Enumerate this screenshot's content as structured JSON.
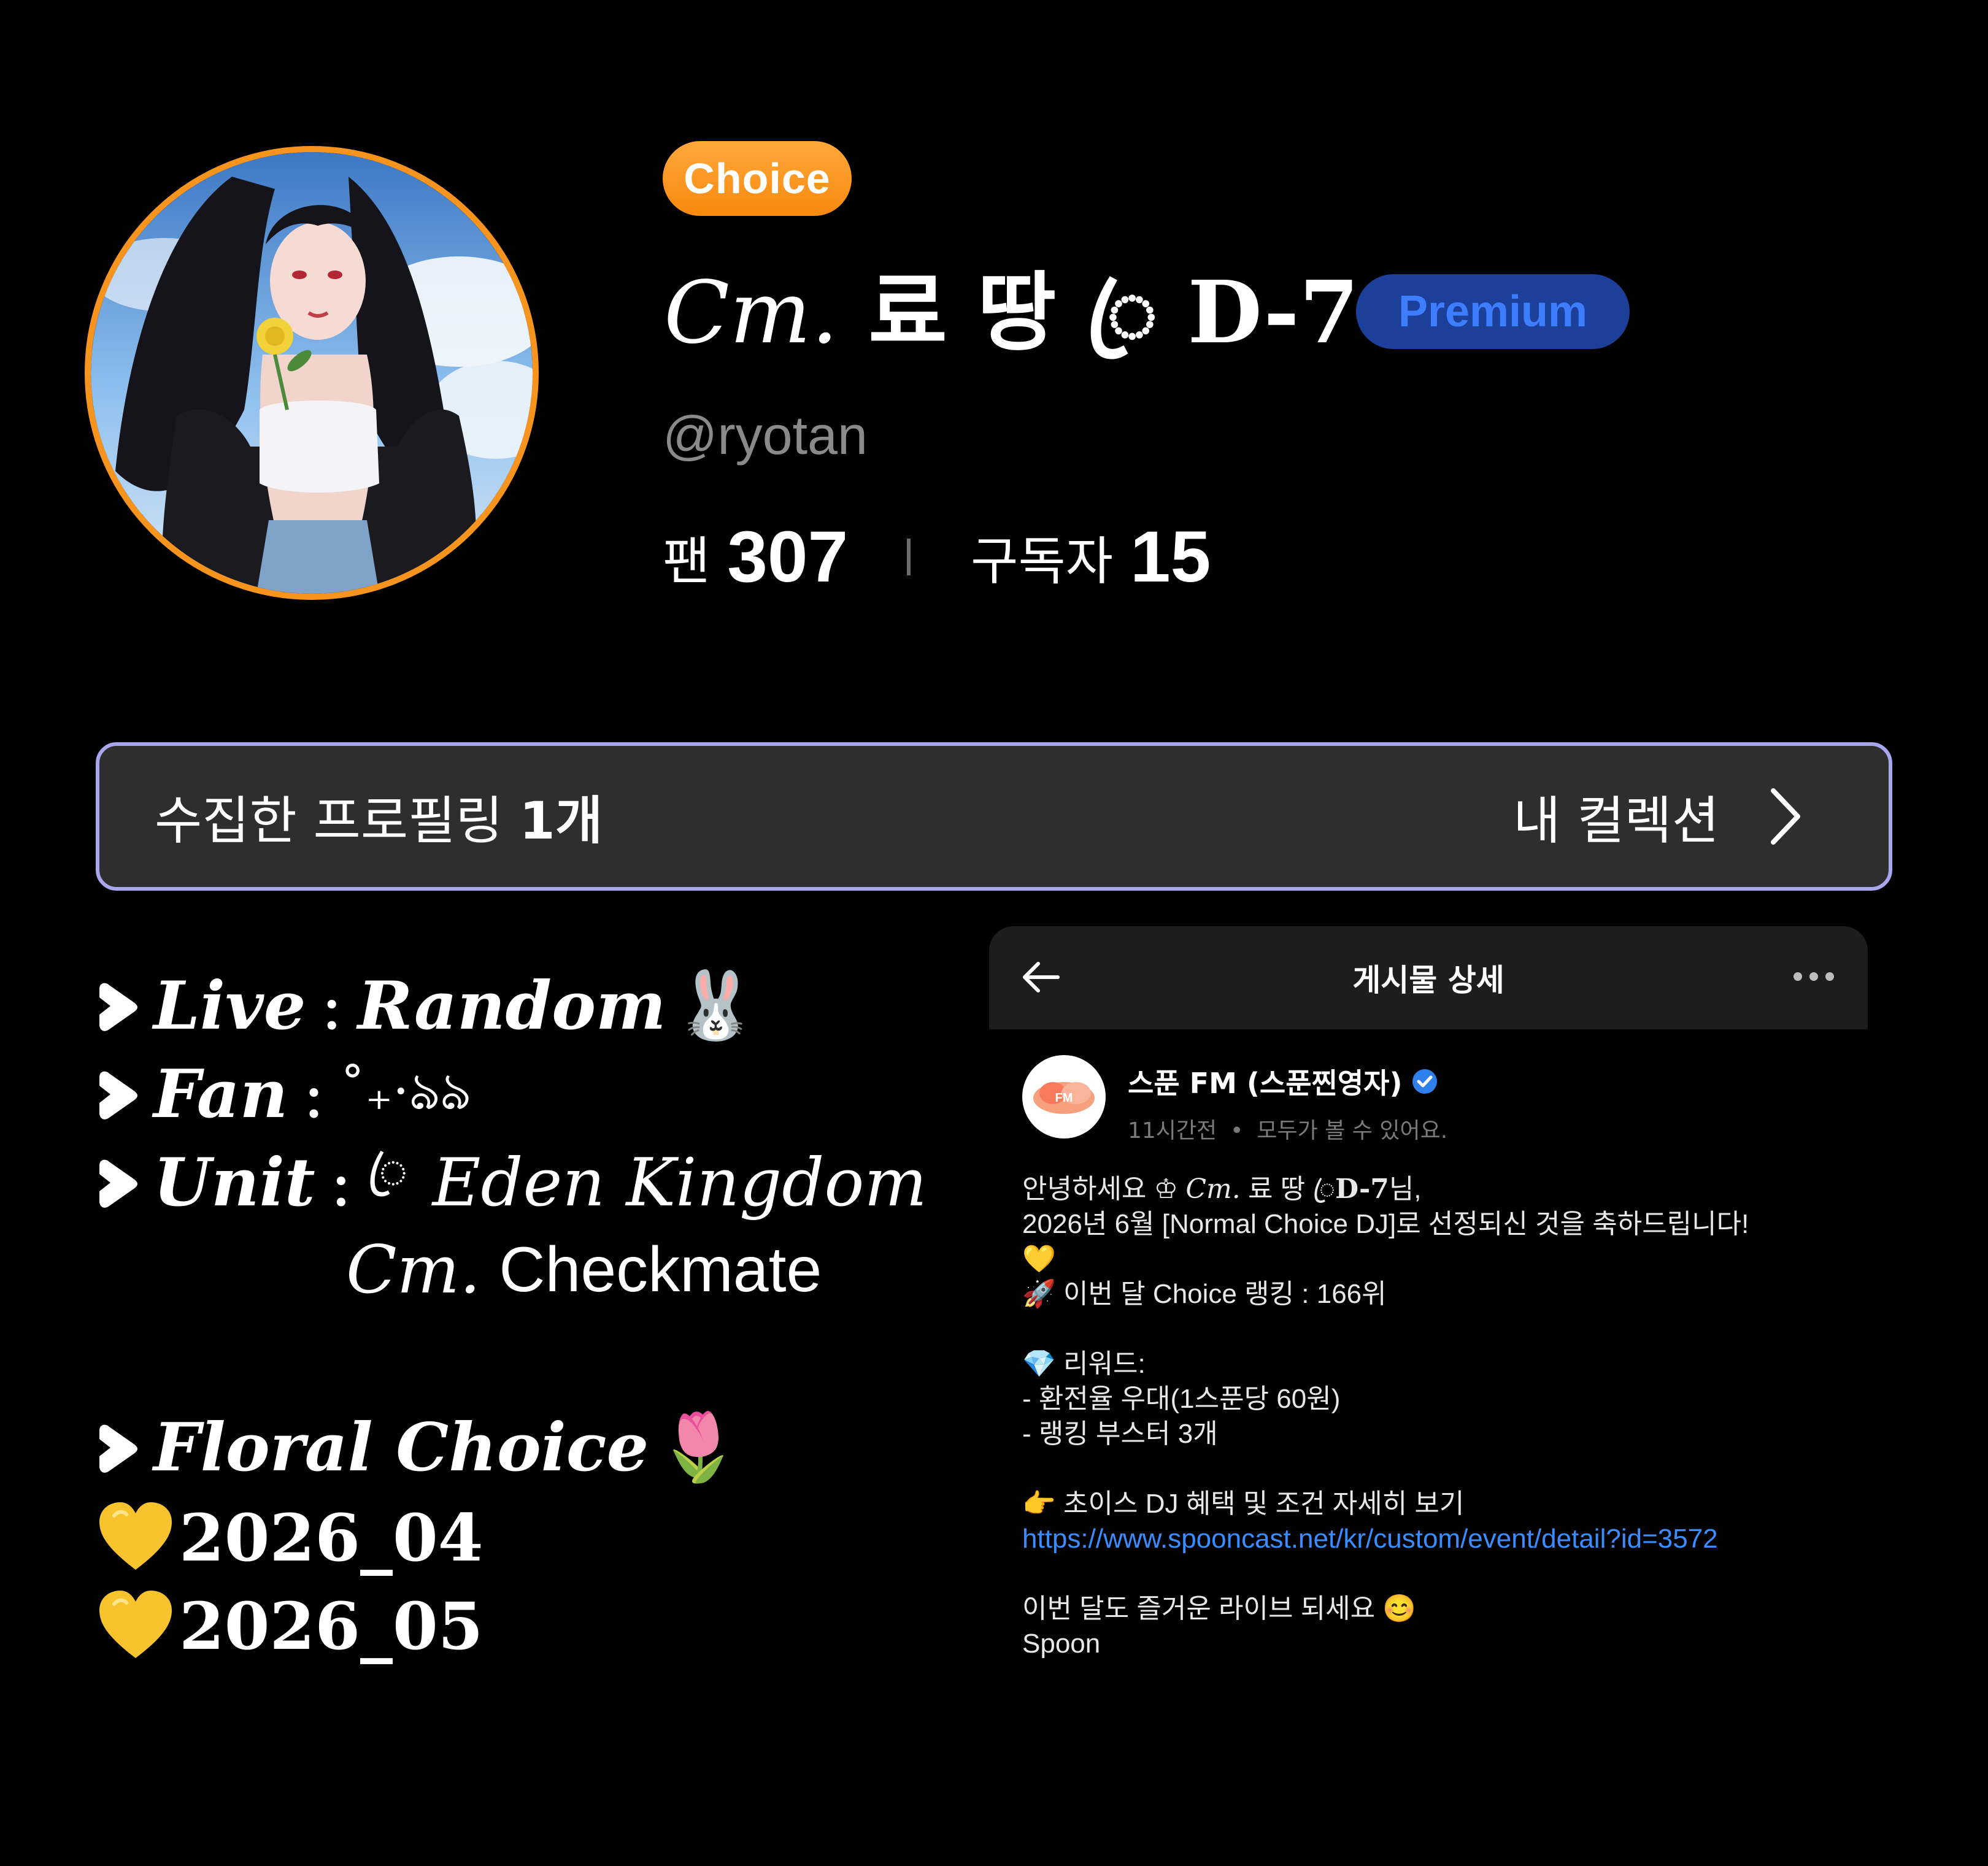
{
  "profile": {
    "choice_badge": "Choice",
    "name_script": "Cm.",
    "name_text": "료 땅",
    "name_ring": "ꦿ",
    "name_suffix": "D-7",
    "premium_badge": "Premium",
    "handle": "@ryotan",
    "stats": {
      "fans_label": "팬",
      "fans_value": "307",
      "subscribers_label": "구독자",
      "subscribers_value": "15"
    },
    "colors": {
      "avatar_ring": "#f7941d",
      "choice_badge": "#f7941d",
      "premium_badge_bg": "#1c3f9a",
      "premium_badge_text": "#3d7dff",
      "collection_border": "#a9a6f0"
    }
  },
  "collection": {
    "label": "수집한 프로필링",
    "count": "1개",
    "link_label": "내 컬렉션",
    "icon": "chevron-right-icon"
  },
  "bio": {
    "live_key": "Live",
    "live_sep": ":",
    "live_value": "Random",
    "live_emoji": "🐰",
    "fan_key": "Fan",
    "fan_sep": ":",
    "fan_value": "˚₊·ঌ⁠ঌ",
    "unit_key": "Unit",
    "unit_sep": ":",
    "unit_ring": "ꦿ",
    "unit_value": "Eden Kingdom",
    "unit_line2_script": "Cm.",
    "unit_line2_text": "Checkmate",
    "floral_label": "Floral Choice",
    "floral_emoji": "🌷",
    "months": [
      "2026_04",
      "2026_05"
    ],
    "bullet_icon": "arrow-bullet-icon",
    "heart_icon": "yellow-heart-icon"
  },
  "post": {
    "header_title": "게시물 상세",
    "back_icon": "arrow-left-icon",
    "more_icon": "more-horizontal-icon",
    "author_name": "스푼 FM (스푼찐영자)",
    "author_verified": true,
    "timestamp": "11시간전",
    "visibility": "모두가 볼 수 있어요.",
    "logo_text": "FM",
    "body": {
      "greeting_prefix": "안녕하세요",
      "greeting_symbol": "♔",
      "greeting_script": "Cm.",
      "greeting_name": "료 땅",
      "greeting_ring": "ꦿ",
      "greeting_suffix": "D-7",
      "greeting_end": "님,",
      "congrats": "2026년 6월 [Normal Choice DJ]로 선정되신 것을 축하드립니다!",
      "heart_emoji": "💛",
      "rocket_emoji": "🚀",
      "ranking": "이번 달 Choice 랭킹 : 166위",
      "diamond_emoji": "💎",
      "reward_title": "리워드:",
      "reward_1": "- 환전율 우대(1스푼당 60원)",
      "reward_2": "- 랭킹 부스터 3개",
      "point_emoji": "👉",
      "detail_text": "초이스 DJ 혜택 및 조건 자세히 보기",
      "link": "https://www.spooncast.net/kr/custom/event/detail?id=3572",
      "closing": "이번 달도 즐거운 라이브 되세요",
      "smile_emoji": "😊",
      "signature": "Spoon"
    }
  }
}
